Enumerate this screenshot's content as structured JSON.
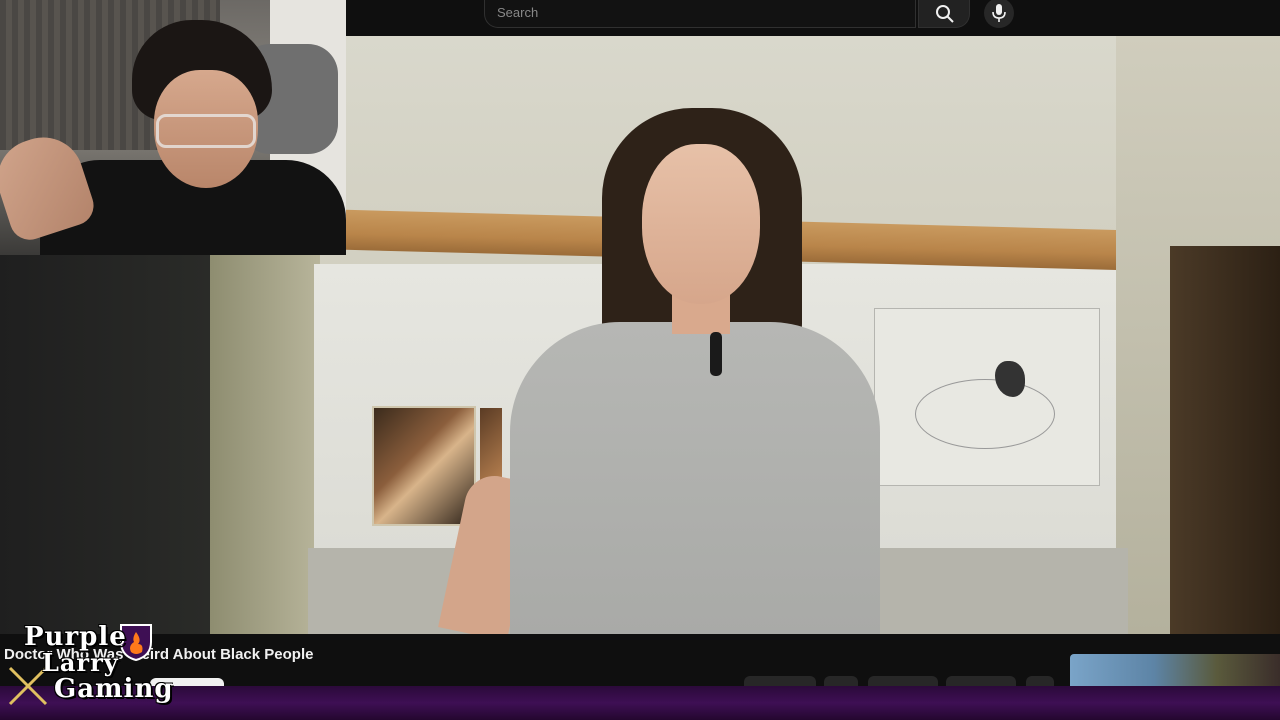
{
  "search": {
    "placeholder": "Search"
  },
  "icons": {
    "search": "search-icon",
    "mic": "mic-icon",
    "logo_swords": "crossed-swords-icon",
    "logo_shield": "flame-shield-icon"
  },
  "video": {
    "title": "Doctor Who Was Weird About Black People"
  },
  "logo": {
    "line1": "Purple",
    "line2": "Larry",
    "line3": "Gaming"
  },
  "colors": {
    "background": "#0f0f0f",
    "logo_accent": "#3e0f54",
    "text": "#f1f1f1"
  }
}
